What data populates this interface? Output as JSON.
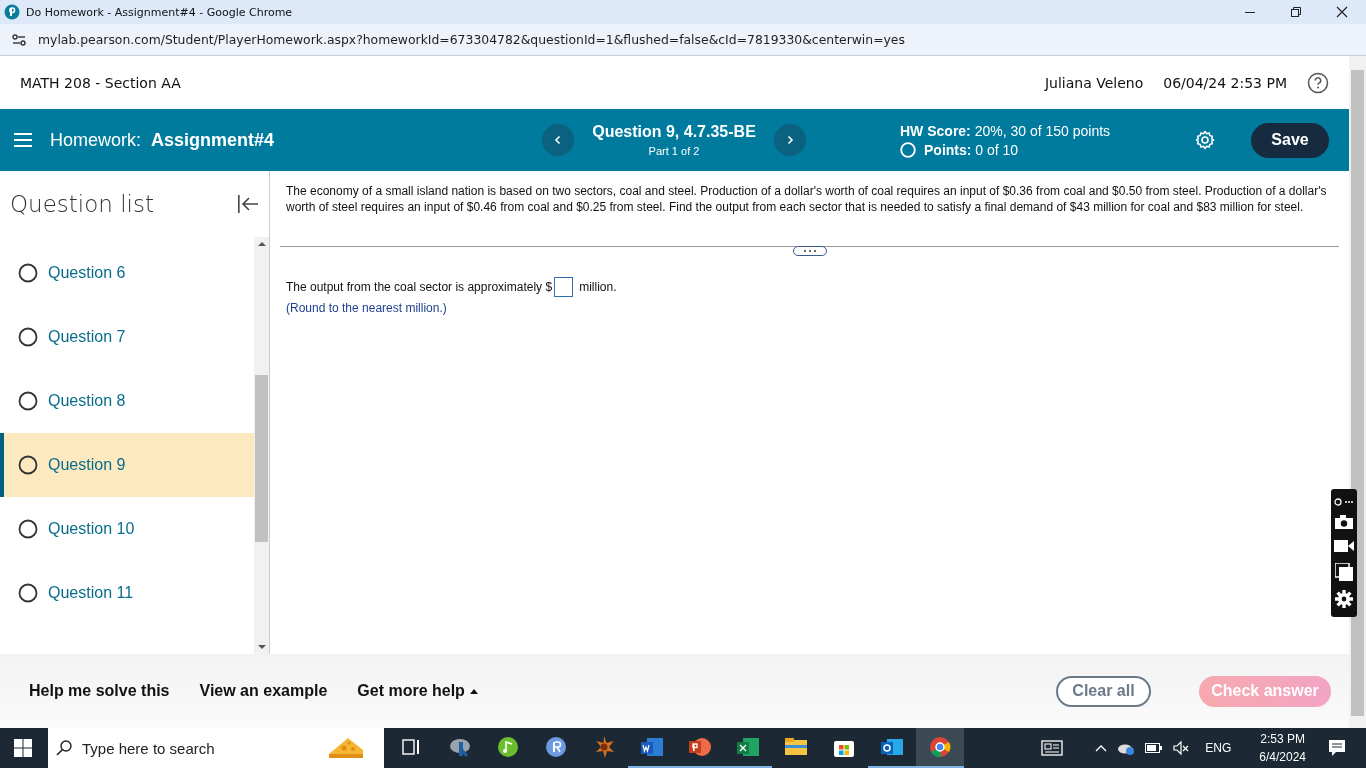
{
  "browser": {
    "tab_title": "Do Homework - Assignment#4 - Google Chrome",
    "url": "mylab.pearson.com/Student/PlayerHomework.aspx?homeworkId=673304782&questionId=1&flushed=false&cId=7819330&centerwin=yes"
  },
  "header": {
    "course": "MATH 208 - Section AA",
    "user": "Juliana Veleno",
    "datetime": "06/04/24 2:53 PM"
  },
  "toolbar": {
    "homework_label": "Homework:",
    "assignment": "Assignment#4",
    "question_title": "Question 9, 4.7.35-BE",
    "part": "Part 1 of 2",
    "hw_score_label": "HW Score:",
    "hw_score": "20%, 30 of 150 points",
    "points_label": "Points:",
    "points": "0 of 10",
    "save": "Save"
  },
  "sidebar": {
    "title": "Question list",
    "questions": [
      {
        "label": "Question 6",
        "selected": false
      },
      {
        "label": "Question 7",
        "selected": false
      },
      {
        "label": "Question 8",
        "selected": false
      },
      {
        "label": "Question 9",
        "selected": true
      },
      {
        "label": "Question 10",
        "selected": false
      },
      {
        "label": "Question 11",
        "selected": false
      }
    ]
  },
  "question": {
    "text": "The economy of a small island nation is based on two sectors, coal and steel. Production of a dollar's worth of coal requires an input of $0.36 from coal and $0.50 from steel. Production of a dollar's worth of steel requires an input of $0.46 from coal and $0.25 from steel. Find the output from each sector that is needed to satisfy a final demand of $43 million for coal and $83 million for steel.",
    "answer_prefix": "The output from the coal sector is approximately $",
    "answer_suffix": "million.",
    "hint": "(Round to the nearest million.)"
  },
  "footer": {
    "links": [
      {
        "label": "Help me solve this",
        "dropdown": false
      },
      {
        "label": "View an example",
        "dropdown": false
      },
      {
        "label": "Get more help",
        "dropdown": true
      }
    ],
    "clear_all": "Clear all",
    "check_answer": {
      "label": "Check answer",
      "disabled": true
    }
  },
  "taskbar": {
    "search_placeholder": "Type here to search",
    "language": "ENG",
    "time": "2:53 PM",
    "date": "6/4/2024"
  }
}
